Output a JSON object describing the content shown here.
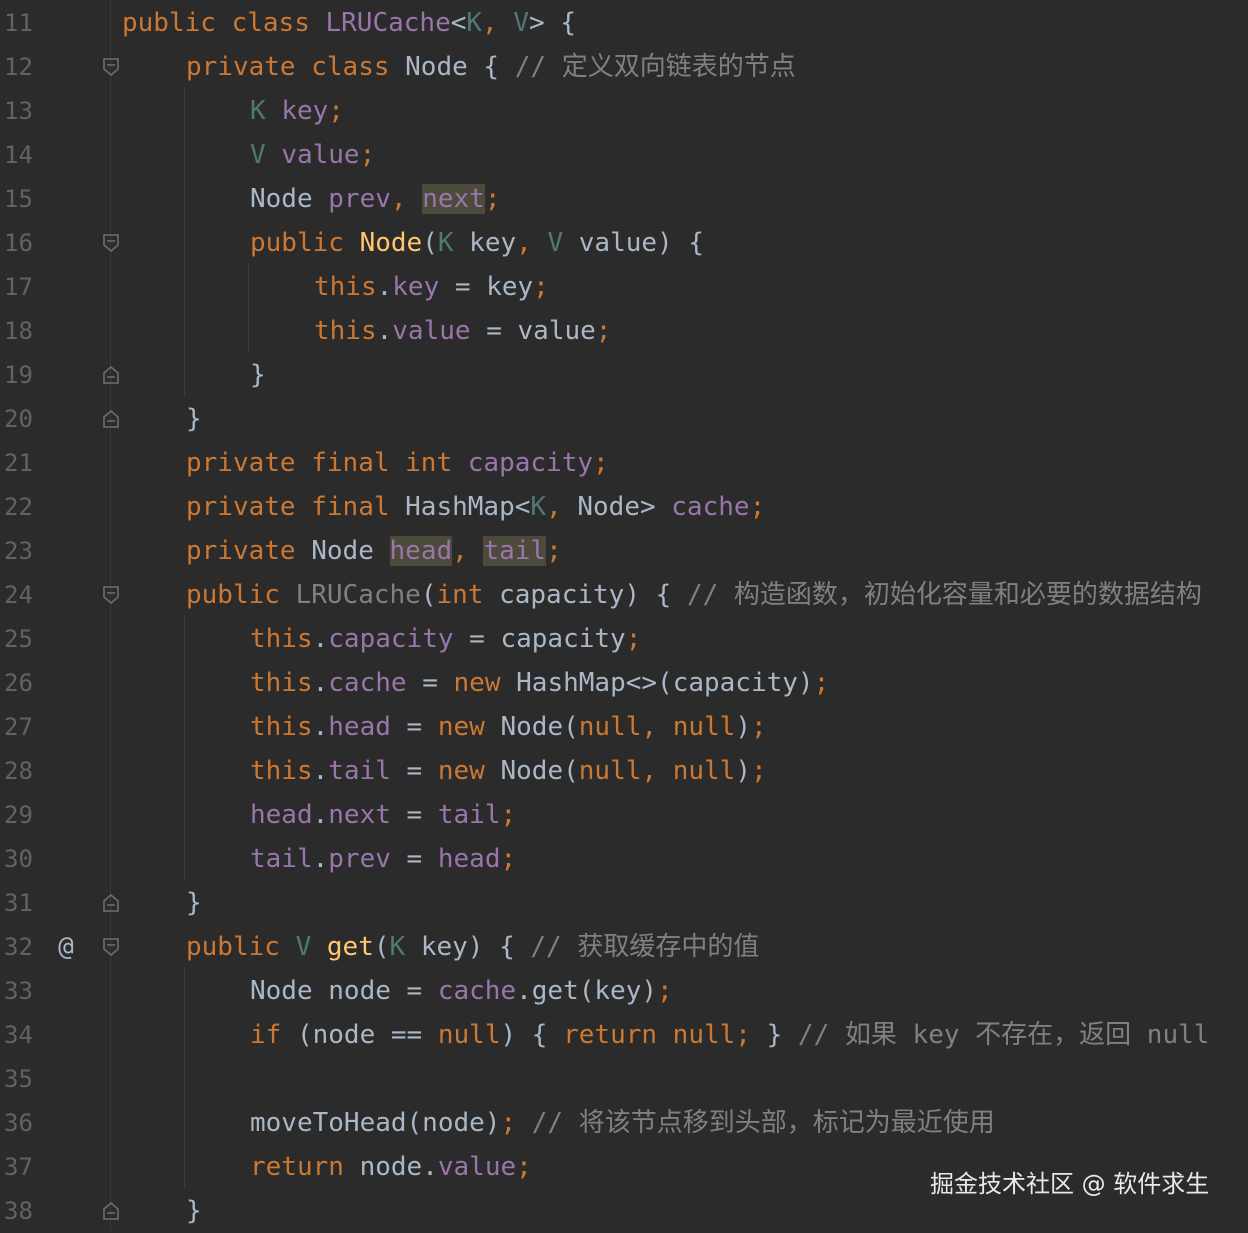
{
  "watermark": "掘金技术社区 @ 软件求生",
  "lines": [
    {
      "num": "11",
      "indent": 0,
      "marker": "",
      "fold": "",
      "tokens": [
        [
          "k",
          "public "
        ],
        [
          "k",
          "class "
        ],
        [
          "f",
          "LRUCache"
        ],
        [
          "p",
          "<"
        ],
        [
          "t",
          "K"
        ],
        [
          "k",
          ", "
        ],
        [
          "t",
          "V"
        ],
        [
          "p",
          "> {"
        ]
      ]
    },
    {
      "num": "12",
      "indent": 1,
      "marker": "",
      "fold": "open",
      "tokens": [
        [
          "k",
          "private "
        ],
        [
          "k",
          "class "
        ],
        [
          "p",
          "Node { "
        ],
        [
          "c",
          "// 定义双向链表的节点"
        ]
      ]
    },
    {
      "num": "13",
      "indent": 2,
      "marker": "",
      "fold": "",
      "tokens": [
        [
          "t",
          "K "
        ],
        [
          "f",
          "key"
        ],
        [
          "k",
          ";"
        ]
      ]
    },
    {
      "num": "14",
      "indent": 2,
      "marker": "",
      "fold": "",
      "tokens": [
        [
          "t",
          "V "
        ],
        [
          "f",
          "value"
        ],
        [
          "k",
          ";"
        ]
      ]
    },
    {
      "num": "15",
      "indent": 2,
      "marker": "",
      "fold": "",
      "tokens": [
        [
          "p",
          "Node "
        ],
        [
          "f",
          "prev"
        ],
        [
          "k",
          ", "
        ],
        [
          "fh",
          "next"
        ],
        [
          "k",
          ";"
        ]
      ]
    },
    {
      "num": "16",
      "indent": 2,
      "marker": "",
      "fold": "open",
      "tokens": [
        [
          "k",
          "public "
        ],
        [
          "m",
          "Node"
        ],
        [
          "p",
          "("
        ],
        [
          "t",
          "K "
        ],
        [
          "p",
          "key"
        ],
        [
          "k",
          ", "
        ],
        [
          "t",
          "V "
        ],
        [
          "p",
          "value) {"
        ]
      ]
    },
    {
      "num": "17",
      "indent": 3,
      "marker": "",
      "fold": "",
      "tokens": [
        [
          "k",
          "this"
        ],
        [
          "p",
          "."
        ],
        [
          "f",
          "key"
        ],
        [
          "p",
          " = key"
        ],
        [
          "k",
          ";"
        ]
      ]
    },
    {
      "num": "18",
      "indent": 3,
      "marker": "",
      "fold": "",
      "tokens": [
        [
          "k",
          "this"
        ],
        [
          "p",
          "."
        ],
        [
          "f",
          "value"
        ],
        [
          "p",
          " = value"
        ],
        [
          "k",
          ";"
        ]
      ]
    },
    {
      "num": "19",
      "indent": 2,
      "marker": "",
      "fold": "close",
      "tokens": [
        [
          "p",
          "}"
        ]
      ]
    },
    {
      "num": "20",
      "indent": 1,
      "marker": "",
      "fold": "close",
      "tokens": [
        [
          "p",
          "}"
        ]
      ]
    },
    {
      "num": "21",
      "indent": 1,
      "marker": "",
      "fold": "",
      "tokens": [
        [
          "k",
          "private "
        ],
        [
          "k",
          "final "
        ],
        [
          "k",
          "int "
        ],
        [
          "f",
          "capacity"
        ],
        [
          "k",
          ";"
        ]
      ]
    },
    {
      "num": "22",
      "indent": 1,
      "marker": "",
      "fold": "",
      "tokens": [
        [
          "k",
          "private "
        ],
        [
          "k",
          "final "
        ],
        [
          "p",
          "HashMap<"
        ],
        [
          "t",
          "K"
        ],
        [
          "k",
          ", "
        ],
        [
          "p",
          "Node> "
        ],
        [
          "f",
          "cache"
        ],
        [
          "k",
          ";"
        ]
      ]
    },
    {
      "num": "23",
      "indent": 1,
      "marker": "",
      "fold": "",
      "tokens": [
        [
          "k",
          "private "
        ],
        [
          "p",
          "Node "
        ],
        [
          "fh",
          "head"
        ],
        [
          "k",
          ", "
        ],
        [
          "fh",
          "tail"
        ],
        [
          "k",
          ";"
        ]
      ]
    },
    {
      "num": "24",
      "indent": 1,
      "marker": "",
      "fold": "open",
      "tokens": [
        [
          "k",
          "public "
        ],
        [
          "c",
          "LRUCache"
        ],
        [
          "p",
          "("
        ],
        [
          "k",
          "int "
        ],
        [
          "p",
          "capacity) { "
        ],
        [
          "c",
          "// 构造函数，初始化容量和必要的数据结构"
        ]
      ]
    },
    {
      "num": "25",
      "indent": 2,
      "marker": "",
      "fold": "",
      "tokens": [
        [
          "k",
          "this"
        ],
        [
          "p",
          "."
        ],
        [
          "f",
          "capacity"
        ],
        [
          "p",
          " = capacity"
        ],
        [
          "k",
          ";"
        ]
      ]
    },
    {
      "num": "26",
      "indent": 2,
      "marker": "",
      "fold": "",
      "tokens": [
        [
          "k",
          "this"
        ],
        [
          "p",
          "."
        ],
        [
          "f",
          "cache"
        ],
        [
          "p",
          " = "
        ],
        [
          "k",
          "new "
        ],
        [
          "p",
          "HashMap<>(capacity)"
        ],
        [
          "k",
          ";"
        ]
      ]
    },
    {
      "num": "27",
      "indent": 2,
      "marker": "",
      "fold": "",
      "tokens": [
        [
          "k",
          "this"
        ],
        [
          "p",
          "."
        ],
        [
          "f",
          "head"
        ],
        [
          "p",
          " = "
        ],
        [
          "k",
          "new "
        ],
        [
          "p",
          "Node("
        ],
        [
          "k",
          "null, null"
        ],
        [
          "p",
          ")"
        ],
        [
          "k",
          ";"
        ]
      ]
    },
    {
      "num": "28",
      "indent": 2,
      "marker": "",
      "fold": "",
      "tokens": [
        [
          "k",
          "this"
        ],
        [
          "p",
          "."
        ],
        [
          "f",
          "tail"
        ],
        [
          "p",
          " = "
        ],
        [
          "k",
          "new "
        ],
        [
          "p",
          "Node("
        ],
        [
          "k",
          "null, null"
        ],
        [
          "p",
          ")"
        ],
        [
          "k",
          ";"
        ]
      ]
    },
    {
      "num": "29",
      "indent": 2,
      "marker": "",
      "fold": "",
      "tokens": [
        [
          "f",
          "head"
        ],
        [
          "p",
          "."
        ],
        [
          "f",
          "next"
        ],
        [
          "p",
          " = "
        ],
        [
          "f",
          "tail"
        ],
        [
          "k",
          ";"
        ]
      ]
    },
    {
      "num": "30",
      "indent": 2,
      "marker": "",
      "fold": "",
      "tokens": [
        [
          "f",
          "tail"
        ],
        [
          "p",
          "."
        ],
        [
          "f",
          "prev"
        ],
        [
          "p",
          " = "
        ],
        [
          "f",
          "head"
        ],
        [
          "k",
          ";"
        ]
      ]
    },
    {
      "num": "31",
      "indent": 1,
      "marker": "",
      "fold": "close",
      "tokens": [
        [
          "p",
          "}"
        ]
      ]
    },
    {
      "num": "32",
      "indent": 1,
      "marker": "@",
      "fold": "open",
      "tokens": [
        [
          "k",
          "public "
        ],
        [
          "t",
          "V "
        ],
        [
          "m",
          "get"
        ],
        [
          "p",
          "("
        ],
        [
          "t",
          "K "
        ],
        [
          "p",
          "key) { "
        ],
        [
          "c",
          "// 获取缓存中的值"
        ]
      ]
    },
    {
      "num": "33",
      "indent": 2,
      "marker": "",
      "fold": "",
      "tokens": [
        [
          "p",
          "Node node = "
        ],
        [
          "f",
          "cache"
        ],
        [
          "p",
          ".get(key)"
        ],
        [
          "k",
          ";"
        ]
      ]
    },
    {
      "num": "34",
      "indent": 2,
      "marker": "",
      "fold": "",
      "tokens": [
        [
          "k",
          "if "
        ],
        [
          "p",
          "(node == "
        ],
        [
          "k",
          "null"
        ],
        [
          "p",
          ") { "
        ],
        [
          "k",
          "return null; "
        ],
        [
          "p",
          "} "
        ],
        [
          "c",
          "// 如果 key 不存在，返回 null"
        ]
      ]
    },
    {
      "num": "35",
      "indent": 2,
      "marker": "",
      "fold": "",
      "tokens": []
    },
    {
      "num": "36",
      "indent": 2,
      "marker": "",
      "fold": "",
      "tokens": [
        [
          "p",
          "moveToHead(node)"
        ],
        [
          "k",
          "; "
        ],
        [
          "c",
          "// 将该节点移到头部，标记为最近使用"
        ]
      ]
    },
    {
      "num": "37",
      "indent": 2,
      "marker": "",
      "fold": "",
      "tokens": [
        [
          "k",
          "return "
        ],
        [
          "p",
          "node."
        ],
        [
          "f",
          "value"
        ],
        [
          "k",
          ";"
        ]
      ]
    },
    {
      "num": "38",
      "indent": 1,
      "marker": "",
      "fold": "close",
      "tokens": [
        [
          "p",
          "}"
        ]
      ]
    }
  ]
}
